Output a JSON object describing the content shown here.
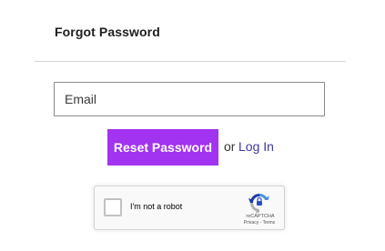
{
  "form": {
    "title": "Forgot Password",
    "email_placeholder": "Email",
    "email_value": "",
    "reset_label": "Reset Password",
    "or_text": "or",
    "login_label": "Log In"
  },
  "recaptcha": {
    "label": "I'm not a robot",
    "brand": "reCAPTCHA",
    "privacy": "Privacy",
    "separator": " - ",
    "terms": "Terms",
    "checked": false,
    "icon": "recaptcha-logo-icon"
  },
  "colors": {
    "accent": "#a233f0",
    "link": "#3a3a9a",
    "divider": "#d5d5d5"
  }
}
